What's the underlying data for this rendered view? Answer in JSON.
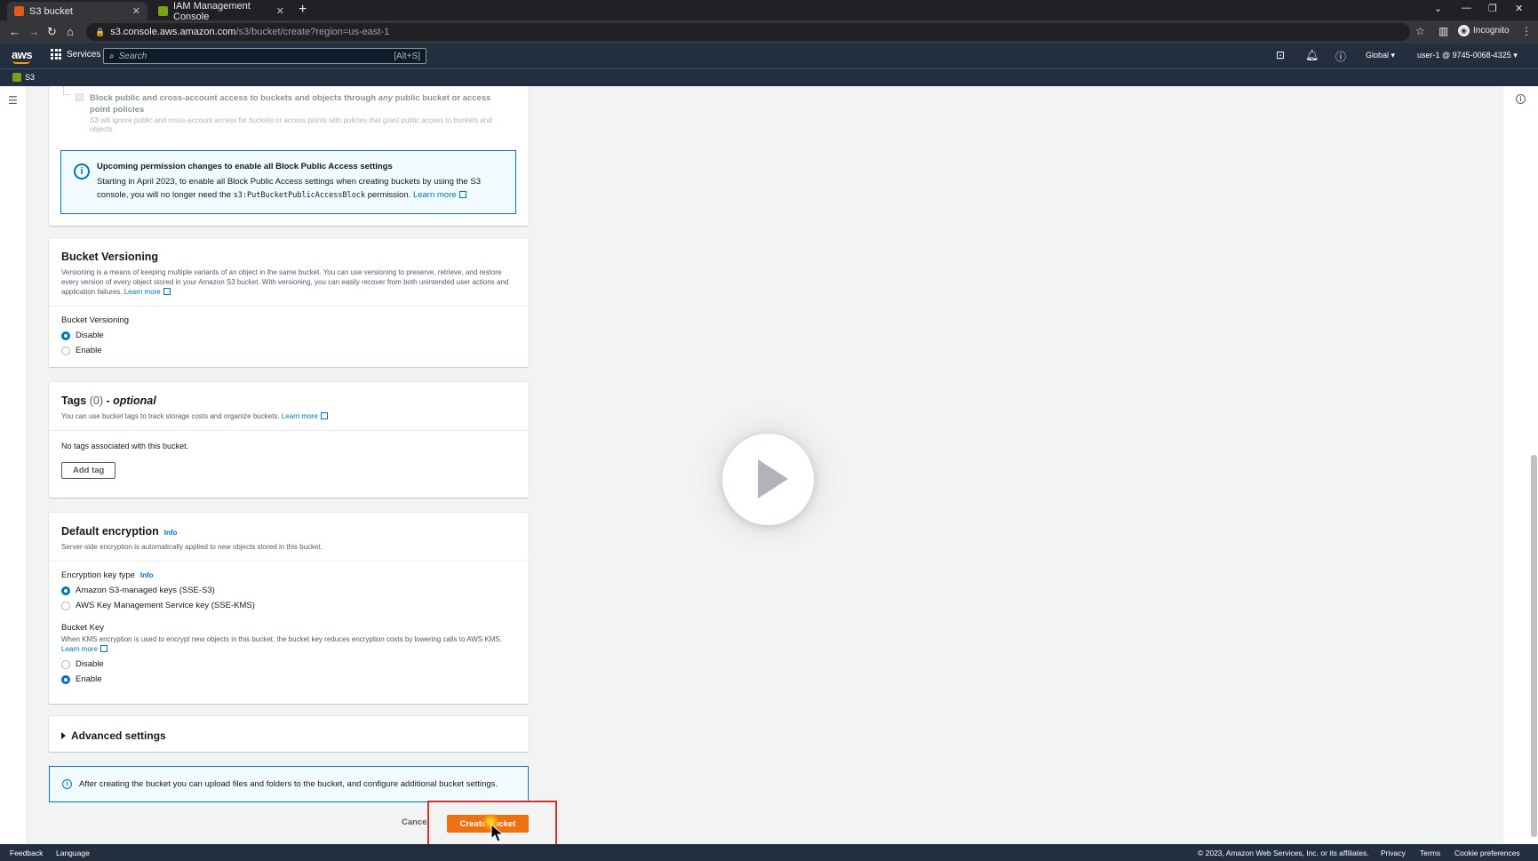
{
  "browser": {
    "tabs": [
      {
        "title": "S3 bucket",
        "active": true
      },
      {
        "title": "IAM Management Console",
        "active": false
      }
    ],
    "url_host": "s3.console.aws.amazon.com",
    "url_path": "/s3/bucket/create?region=us-east-1",
    "profile_label": "Incognito"
  },
  "aws_nav": {
    "logo": "aws",
    "services_label": "Services",
    "search_placeholder": "Search",
    "search_shortcut": "[Alt+S]",
    "region": "Global ▾",
    "account": "user-1 @ 9745-0068-4325 ▾",
    "service_badge": "S3"
  },
  "block_access": {
    "checkbox_title_pre": "Block public and cross-account access to buckets and objects through ",
    "checkbox_title_em": "any",
    "checkbox_title_post": " public bucket or access point policies",
    "checkbox_desc": "S3 will ignore public and cross-account access for buckets or access points with policies that grant public access to buckets and objects.",
    "notice_title": "Upcoming permission changes to enable all Block Public Access settings",
    "notice_text_1": "Starting in April 2023, to enable all Block Public Access settings when creating buckets by using the S3 console, you will no longer need the ",
    "notice_code": "s3:PutBucketPublicAccessBlock",
    "notice_text_2": " permission. ",
    "notice_link": "Learn more"
  },
  "versioning": {
    "title": "Bucket Versioning",
    "desc": "Versioning is a means of keeping multiple variants of an object in the same bucket. You can use versioning to preserve, retrieve, and restore every version of every object stored in your Amazon S3 bucket. With versioning, you can easily recover from both unintended user actions and application failures. ",
    "link": "Learn more",
    "field_label": "Bucket Versioning",
    "options": [
      {
        "label": "Disable",
        "selected": true
      },
      {
        "label": "Enable",
        "selected": false
      }
    ]
  },
  "tags": {
    "title_main": "Tags ",
    "title_count": "(0)",
    "title_optional": " - optional",
    "desc": "You can use bucket tags to track storage costs and organize buckets. ",
    "link": "Learn more",
    "empty_text": "No tags associated with this bucket.",
    "add_button": "Add tag"
  },
  "encryption": {
    "title": "Default encryption",
    "info": "Info",
    "desc": "Server-side encryption is automatically applied to new objects stored in this bucket.",
    "key_type_label": "Encryption key type",
    "key_type_info": "Info",
    "key_options": [
      {
        "label": "Amazon S3-managed keys (SSE-S3)",
        "selected": true
      },
      {
        "label": "AWS Key Management Service key (SSE-KMS)",
        "selected": false
      }
    ],
    "bucket_key_label": "Bucket Key",
    "bucket_key_desc": "When KMS encryption is used to encrypt new objects in this bucket, the bucket key reduces encryption costs by lowering calls to AWS KMS. ",
    "bucket_key_link": "Learn more",
    "bucket_key_options": [
      {
        "label": "Disable",
        "selected": false
      },
      {
        "label": "Enable",
        "selected": true
      }
    ]
  },
  "advanced": {
    "title": "Advanced settings"
  },
  "info_flash": "After creating the bucket you can upload files and folders to the bucket, and configure additional bucket settings.",
  "actions": {
    "cancel": "Cancel",
    "create": "Create bucket"
  },
  "footer": {
    "feedback": "Feedback",
    "language": "Language",
    "copyright": "© 2023, Amazon Web Services, Inc. or its affiliates.",
    "privacy": "Privacy",
    "terms": "Terms",
    "cookies": "Cookie preferences"
  },
  "colors": {
    "aws_nav": "#232f3e",
    "primary_button": "#ec7211",
    "link": "#0073bb",
    "highlight_box": "#d32f2f"
  }
}
